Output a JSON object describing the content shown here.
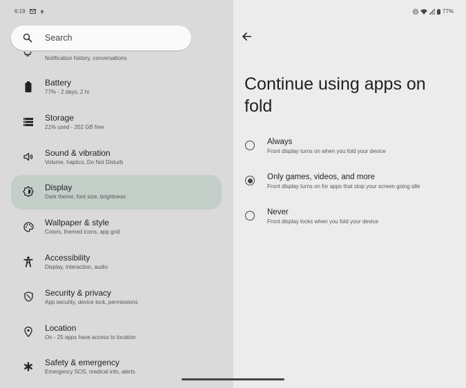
{
  "status_bar": {
    "time": "6:19",
    "battery": "77%"
  },
  "search": {
    "placeholder": "Search"
  },
  "partial_item": {
    "subtitle": "Notification history, conversations"
  },
  "settings": [
    {
      "key": "battery",
      "icon": "battery-icon",
      "title": "Battery",
      "subtitle": "77% - 2 days, 2 hr"
    },
    {
      "key": "storage",
      "icon": "storage-icon",
      "title": "Storage",
      "subtitle": "21% used - 202 GB free"
    },
    {
      "key": "sound",
      "icon": "speaker-icon",
      "title": "Sound & vibration",
      "subtitle": "Volume, haptics, Do Not Disturb"
    },
    {
      "key": "display",
      "icon": "brightness-icon",
      "title": "Display",
      "subtitle": "Dark theme, font size, brightness",
      "selected": true
    },
    {
      "key": "wallpaper",
      "icon": "palette-icon",
      "title": "Wallpaper & style",
      "subtitle": "Colors, themed icons, app grid"
    },
    {
      "key": "accessibility",
      "icon": "accessibility-icon",
      "title": "Accessibility",
      "subtitle": "Display, interaction, audio"
    },
    {
      "key": "security",
      "icon": "shield-icon",
      "title": "Security & privacy",
      "subtitle": "App security, device lock, permissions"
    },
    {
      "key": "location",
      "icon": "location-pin-icon",
      "title": "Location",
      "subtitle": "On - 25 apps have access to location"
    },
    {
      "key": "safety",
      "icon": "asterisk-icon",
      "title": "Safety & emergency",
      "subtitle": "Emergency SOS, medical info, alerts"
    }
  ],
  "detail": {
    "title": "Continue using apps on fold",
    "options": [
      {
        "key": "always",
        "title": "Always",
        "subtitle": "Front display turns on when you fold your device",
        "checked": false
      },
      {
        "key": "games",
        "title": "Only games, videos, and more",
        "subtitle": "Front display turns on for apps that stop your screen going idle",
        "checked": true
      },
      {
        "key": "never",
        "title": "Never",
        "subtitle": "Front display locks when you fold your device",
        "checked": false
      }
    ]
  }
}
